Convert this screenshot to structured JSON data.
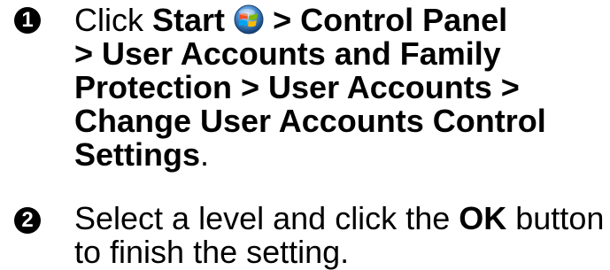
{
  "step1": {
    "number": "1",
    "click_word": "Click",
    "start_label": "Start",
    "path_lines": [
      "> Control Panel",
      "> User Accounts and Family",
      "Protection > User Accounts >",
      "Change User Accounts Control",
      "Settings"
    ],
    "end_punctuation": ".",
    "start_icon": "windows-start-orb-icon"
  },
  "step2": {
    "number": "2",
    "text_before": "Select a level and click the",
    "button_label": "OK",
    "text_after": "button",
    "line2": "to finish the setting."
  }
}
